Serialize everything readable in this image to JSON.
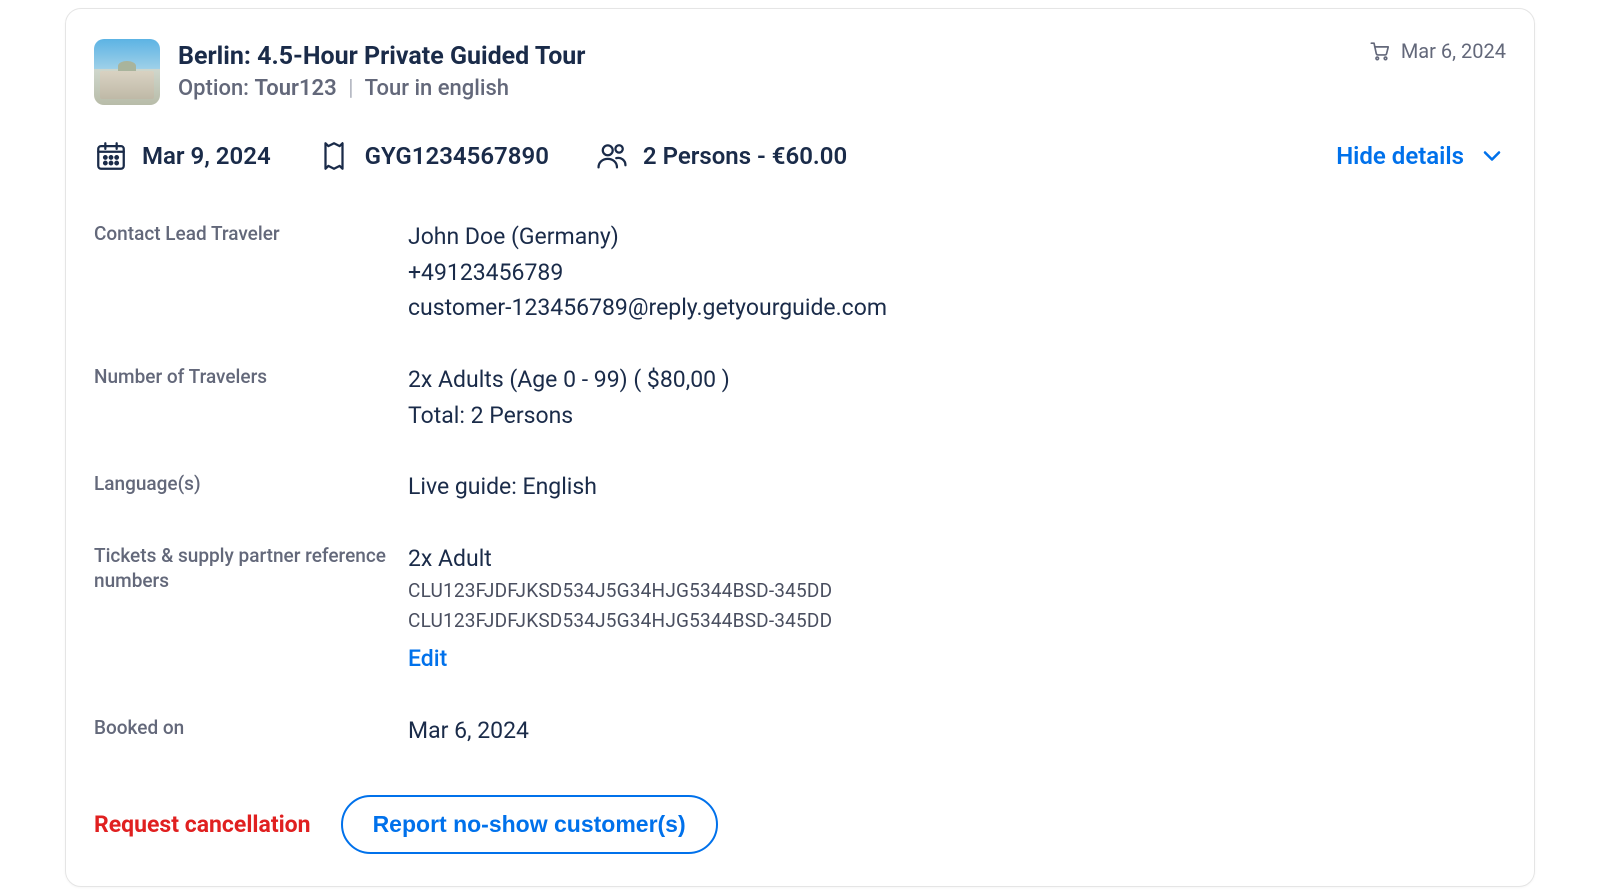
{
  "header": {
    "title": "Berlin: 4.5-Hour Private Guided Tour",
    "option_label": "Option:",
    "option_value": "Tour123",
    "option_tail": "Tour in english",
    "cart_date": "Mar 6, 2024"
  },
  "summary": {
    "date": "Mar 9, 2024",
    "reference": "GYG1234567890",
    "persons": "2 Persons - €60.00",
    "toggle_label": "Hide details"
  },
  "details": {
    "contact": {
      "label": "Contact Lead Traveler",
      "name": "John Doe (Germany)",
      "phone": "+49123456789",
      "email": "customer-123456789@reply.getyourguide.com"
    },
    "travelers": {
      "label": "Number of Travelers",
      "line1": "2x Adults (Age 0 - 99) ( $80,00 )",
      "total": "Total: 2 Persons"
    },
    "languages": {
      "label": "Language(s)",
      "value": "Live guide: English"
    },
    "tickets": {
      "label": "Tickets & supply partner reference numbers",
      "heading": "2x Adult",
      "ref1": "CLU123FJDFJKSD534J5G34HJG5344BSD-345DD",
      "ref2": "CLU123FJDFJKSD534J5G34HJG5344BSD-345DD",
      "edit": "Edit"
    },
    "booked_on": {
      "label": "Booked on",
      "value": "Mar 6, 2024"
    }
  },
  "actions": {
    "cancel": "Request cancellation",
    "no_show": "Report no-show customer(s)"
  }
}
